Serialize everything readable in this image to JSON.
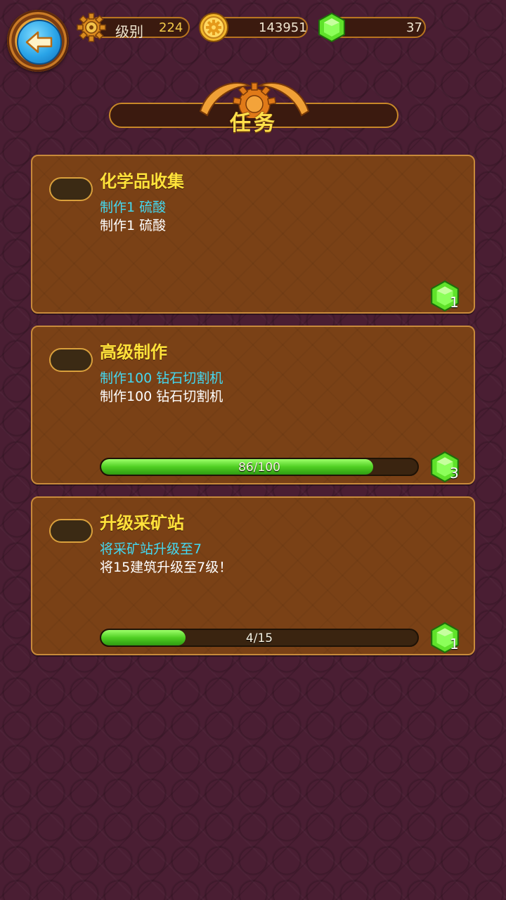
{
  "header": {
    "back_icon": "back-arrow-icon",
    "level_label": "级别",
    "level_value": "224",
    "coins_value": "143951",
    "gems_value": "37"
  },
  "title": "任务",
  "quests": [
    {
      "title": "化学品收集",
      "goal": "制作1  硫酸",
      "description": "制作1  硫酸",
      "reward": "1"
    },
    {
      "title": "高级制作",
      "goal": "制作100  钻石切割机",
      "description": "制作100  钻石切割机",
      "progress_text": "86/100",
      "progress": 0.86,
      "reward": "3"
    },
    {
      "title": "升级采矿站",
      "goal": "将采矿站升级至7",
      "description": "将15建筑升级至7级！",
      "progress_text": "4/15",
      "progress": 0.267,
      "reward": "1"
    }
  ],
  "colors": {
    "title_yellow": "#ffe23a",
    "goal_cyan": "#44d8f0",
    "progress_green": "#4fcf22"
  }
}
